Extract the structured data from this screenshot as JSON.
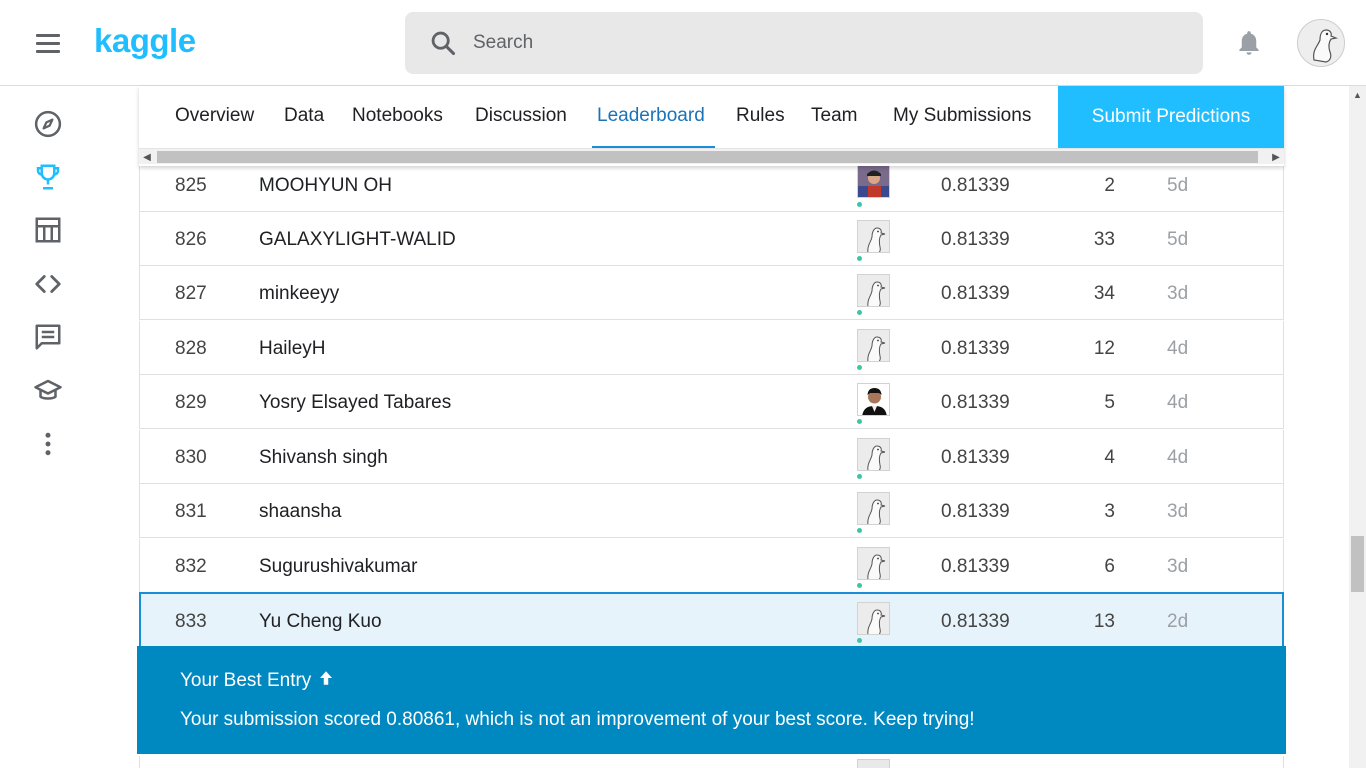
{
  "header": {
    "logo_text": "kaggle",
    "search_placeholder": "Search"
  },
  "sidebar": {
    "items": [
      {
        "name": "compass-icon",
        "label": "Home"
      },
      {
        "name": "trophy-icon",
        "label": "Competitions"
      },
      {
        "name": "table-icon",
        "label": "Datasets"
      },
      {
        "name": "code-icon",
        "label": "Code"
      },
      {
        "name": "comment-icon",
        "label": "Discussions"
      },
      {
        "name": "graduation-cap-icon",
        "label": "Learn"
      },
      {
        "name": "more-vertical-icon",
        "label": "More"
      }
    ],
    "active": "Competitions"
  },
  "tabs": {
    "items": [
      "Overview",
      "Data",
      "Notebooks",
      "Discussion",
      "Leaderboard",
      "Rules",
      "Team",
      "My Submissions"
    ],
    "active": "Leaderboard",
    "submit_label": "Submit Predictions"
  },
  "leaderboard": {
    "rows": [
      {
        "rank": "825",
        "team": "MOOHYUN OH",
        "score": "0.81339",
        "entries": "2",
        "last": "5d",
        "avatar": "photo-person"
      },
      {
        "rank": "826",
        "team": "GALAXYLIGHT-WALID",
        "score": "0.81339",
        "entries": "33",
        "last": "5d",
        "avatar": "default-goose"
      },
      {
        "rank": "827",
        "team": "minkeeyy",
        "score": "0.81339",
        "entries": "34",
        "last": "3d",
        "avatar": "default-goose"
      },
      {
        "rank": "828",
        "team": "HaileyH",
        "score": "0.81339",
        "entries": "12",
        "last": "4d",
        "avatar": "default-goose"
      },
      {
        "rank": "829",
        "team": "Yosry Elsayed Tabares",
        "score": "0.81339",
        "entries": "5",
        "last": "4d",
        "avatar": "photo-person"
      },
      {
        "rank": "830",
        "team": "Shivansh singh",
        "score": "0.81339",
        "entries": "4",
        "last": "4d",
        "avatar": "default-goose"
      },
      {
        "rank": "831",
        "team": "shaansha",
        "score": "0.81339",
        "entries": "3",
        "last": "3d",
        "avatar": "default-goose"
      },
      {
        "rank": "832",
        "team": "Sugurushivakumar",
        "score": "0.81339",
        "entries": "6",
        "last": "3d",
        "avatar": "default-goose"
      },
      {
        "rank": "833",
        "team": "Yu Cheng Kuo",
        "score": "0.81339",
        "entries": "13",
        "last": "2d",
        "avatar": "default-goose",
        "highlight": true
      }
    ]
  },
  "banner": {
    "title": "Your Best Entry",
    "message": "Your submission scored 0.80861, which is not an improvement of your best score. Keep trying!"
  },
  "colors": {
    "brand": "#20beff",
    "active_tab": "#1a73b8",
    "banner_bg": "#0088c1",
    "highlight_bg": "#e6f3fa",
    "status_dot": "#3ec5a6"
  }
}
